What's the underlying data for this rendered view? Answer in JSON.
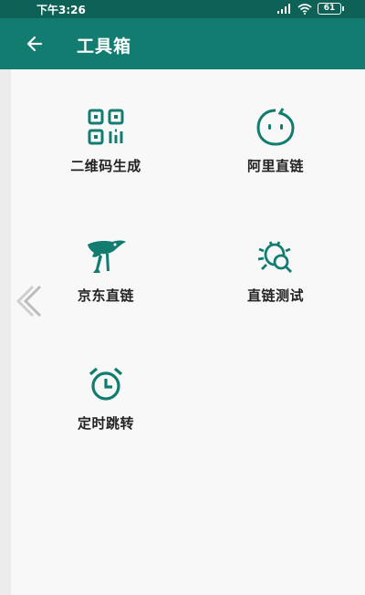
{
  "status_bar": {
    "time": "下午3:26",
    "battery": "61"
  },
  "app_bar": {
    "title": "工具箱"
  },
  "tools": [
    {
      "label": "二维码生成",
      "icon": "qr-code-icon"
    },
    {
      "label": "阿里直链",
      "icon": "alibaba-face-icon"
    },
    {
      "label": "京东直链",
      "icon": "jd-dog-icon"
    },
    {
      "label": "直链测试",
      "icon": "bug-search-icon"
    },
    {
      "label": "定时跳转",
      "icon": "alarm-clock-icon"
    }
  ],
  "colors": {
    "primary": "#117c6f",
    "status": "#0e6157",
    "icon": "#117c6f"
  }
}
